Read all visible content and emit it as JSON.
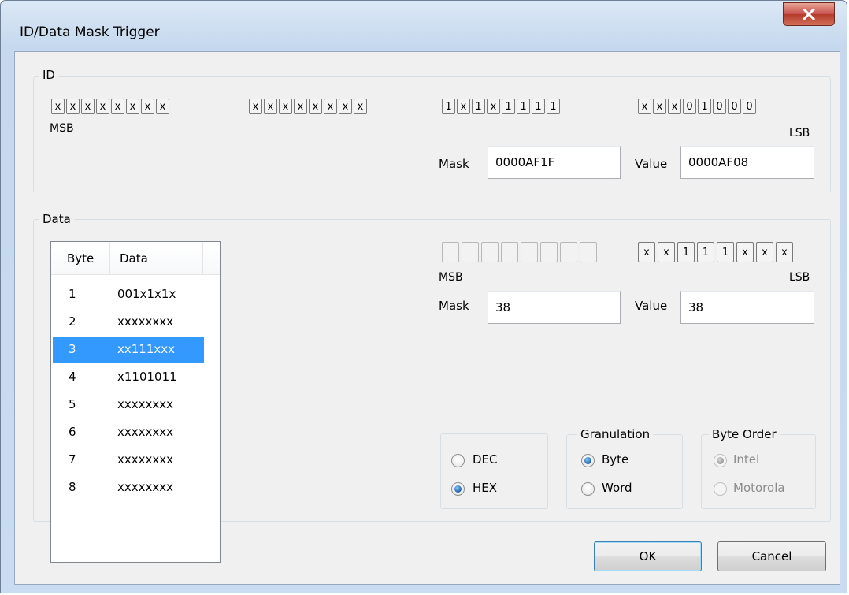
{
  "window": {
    "title": "ID/Data Mask Trigger",
    "close_glyph": "X"
  },
  "id_group": {
    "title": "ID",
    "bits": [
      [
        "x",
        "x",
        "x",
        "x",
        "x",
        "x",
        "x",
        "x"
      ],
      [
        "x",
        "x",
        "x",
        "x",
        "x",
        "x",
        "x",
        "x"
      ],
      [
        "1",
        "x",
        "1",
        "x",
        "1",
        "1",
        "1",
        "1"
      ],
      [
        "x",
        "x",
        "x",
        "0",
        "1",
        "0",
        "0",
        "0"
      ]
    ],
    "msb_label": "MSB",
    "lsb_label": "LSB",
    "mask_label": "Mask",
    "mask_value": "0000AF1F",
    "value_label": "Value",
    "value_value": "0000AF08"
  },
  "data_group": {
    "title": "Data",
    "list": {
      "columns": [
        "Byte",
        "Data"
      ],
      "rows": [
        {
          "byte": "1",
          "data": "001x1x1x"
        },
        {
          "byte": "2",
          "data": "xxxxxxxx"
        },
        {
          "byte": "3",
          "data": "xx111xxx"
        },
        {
          "byte": "4",
          "data": "x1101011"
        },
        {
          "byte": "5",
          "data": "xxxxxxxx"
        },
        {
          "byte": "6",
          "data": "xxxxxxxx"
        },
        {
          "byte": "7",
          "data": "xxxxxxxx"
        },
        {
          "byte": "8",
          "data": "xxxxxxxx"
        }
      ],
      "selected_index": 2
    },
    "bits_right": [
      "x",
      "x",
      "1",
      "1",
      "1",
      "x",
      "x",
      "x"
    ],
    "msb_label": "MSB",
    "lsb_label": "LSB",
    "mask_label": "Mask",
    "mask_value": "38",
    "value_label": "Value",
    "value_value": "38",
    "format": {
      "dec_label": "DEC",
      "hex_label": "HEX",
      "selected": "HEX"
    },
    "granulation": {
      "title": "Granulation",
      "byte_label": "Byte",
      "word_label": "Word",
      "selected": "Byte"
    },
    "byte_order": {
      "title": "Byte Order",
      "intel_label": "Intel",
      "motorola_label": "Motorola",
      "selected": "Intel",
      "disabled": true
    }
  },
  "buttons": {
    "ok_label": "OK",
    "cancel_label": "Cancel"
  },
  "colors": {
    "selection": "#3399ff",
    "close_button": "#c75050",
    "default_button_border": "#3c7fb1"
  }
}
